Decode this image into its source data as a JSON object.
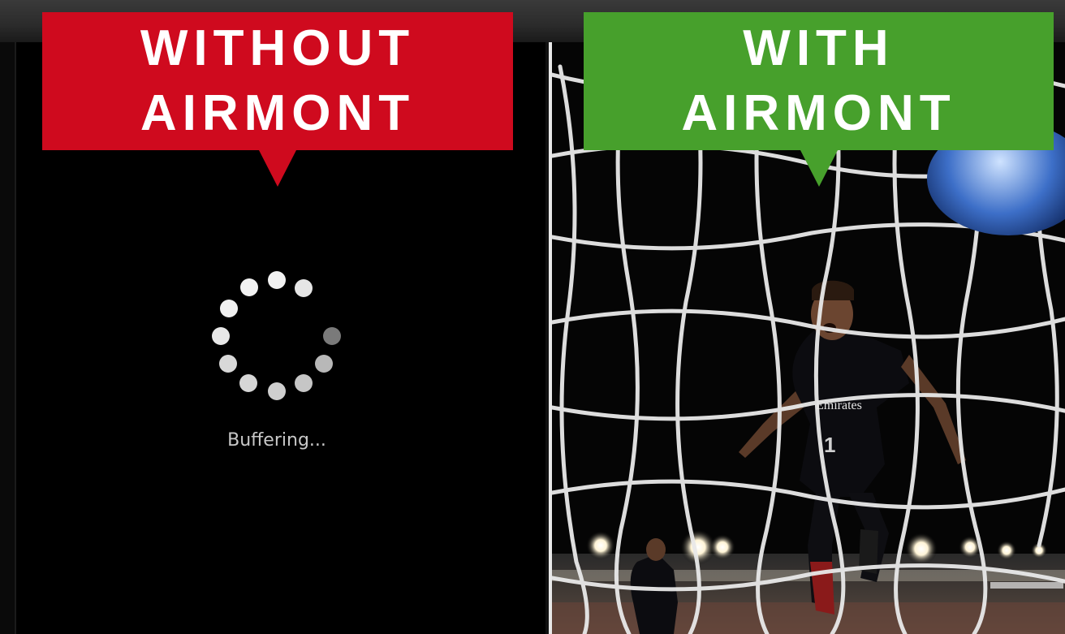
{
  "left": {
    "banner_line1": "WITHOUT",
    "banner_line2": "AIRMONT",
    "status_text": "Buffering..."
  },
  "right": {
    "banner_line1": "WITH",
    "banner_line2": "AIRMONT",
    "jersey_text": "Emirates"
  },
  "colors": {
    "without_banner": "#cf0a1e",
    "with_banner": "#47a02c",
    "background": "#000000"
  },
  "icons": {
    "spinner": "loading-spinner-icon",
    "soccer_ball": "soccer-ball-icon"
  }
}
